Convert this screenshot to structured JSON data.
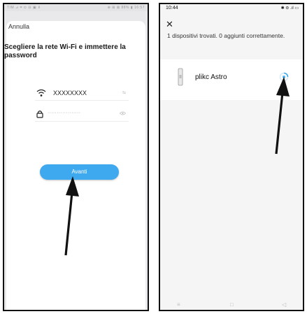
{
  "left_screen": {
    "status_left": "TIM ⊿ ⌗ ⊙ ⊟ ▣ ⊻",
    "status_right": "⊕ ⊞ ⊠ 88% ▮ 16:57",
    "cancel_label": "Annulla",
    "heading": "Scegliere la rete Wi-Fi e immettere la password",
    "wifi_ssid": "XXXXXXXX",
    "wifi_trail": "⇆",
    "password_value": "··················",
    "submit_label": "Avanti"
  },
  "right_screen": {
    "time": "10:44",
    "status_icons": "✱ ⊜ .ıl ▭",
    "message": "1 dispositivi trovati. 0 aggiunti correttamente.",
    "device_name": "plikc Astro",
    "nav_menu": "≡",
    "nav_home": "□",
    "nav_back": "◁"
  },
  "colors": {
    "accent_blue": "#3fa9f0",
    "frame_border": "#111111"
  },
  "icons": [
    "wifi-icon",
    "lock-icon",
    "eye-icon",
    "close-icon",
    "spinner-icon",
    "device-icon",
    "arrow-annotation"
  ]
}
